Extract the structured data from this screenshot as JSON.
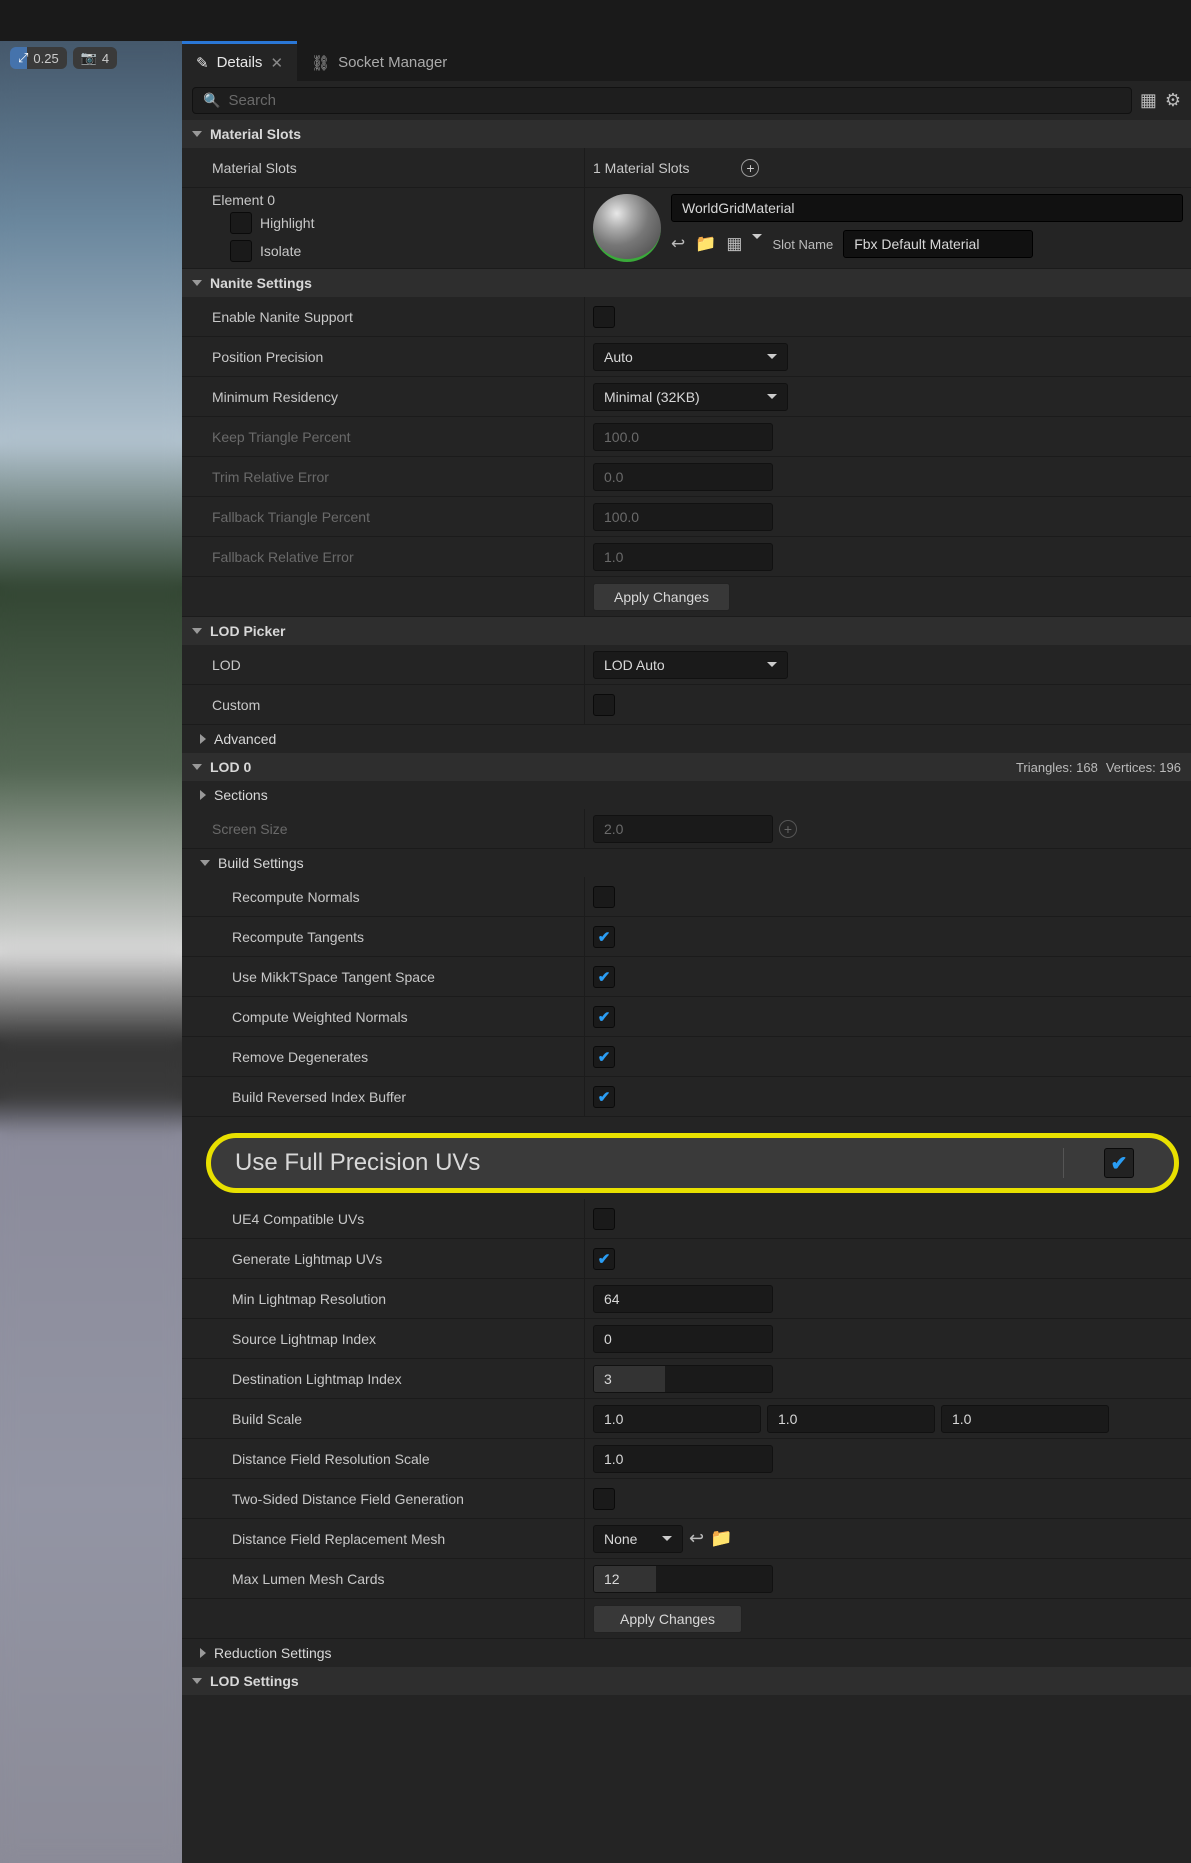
{
  "viewport": {
    "speed": "0.25",
    "cam": "4"
  },
  "tabs": {
    "details": "Details",
    "socket": "Socket Manager"
  },
  "search": {
    "placeholder": "Search"
  },
  "sections": {
    "materialSlots": {
      "header": "Material Slots",
      "label": "Material Slots",
      "count": "1 Material Slots",
      "element": "Element 0",
      "highlight": "Highlight",
      "isolate": "Isolate",
      "matName": "WorldGridMaterial",
      "slotNameLabel": "Slot Name",
      "slotName": "Fbx Default Material"
    },
    "nanite": {
      "header": "Nanite Settings",
      "enable": "Enable Nanite Support",
      "posPrec": "Position Precision",
      "posPrecVal": "Auto",
      "minRes": "Minimum Residency",
      "minResVal": "Minimal (32KB)",
      "keepTri": "Keep Triangle Percent",
      "keepTriVal": "100.0",
      "trimErr": "Trim Relative Error",
      "trimErrVal": "0.0",
      "fallTri": "Fallback Triangle Percent",
      "fallTriVal": "100.0",
      "fallErr": "Fallback Relative Error",
      "fallErrVal": "1.0",
      "apply": "Apply Changes"
    },
    "lodPicker": {
      "header": "LOD Picker",
      "lod": "LOD",
      "lodVal": "LOD Auto",
      "custom": "Custom",
      "advanced": "Advanced"
    },
    "lod0": {
      "header": "LOD 0",
      "tris": "Triangles: 168",
      "verts": "Vertices: 196",
      "sections": "Sections",
      "screenSize": "Screen Size",
      "screenSizeVal": "2.0",
      "build": "Build Settings",
      "recompNormals": "Recompute Normals",
      "recompTangents": "Recompute Tangents",
      "mikkt": "Use MikkTSpace Tangent Space",
      "weighted": "Compute Weighted Normals",
      "degen": "Remove Degenerates",
      "reversed": "Build Reversed Index Buffer",
      "fullPrec": "Use Full Precision UVs",
      "ue4uv": "UE4 Compatible UVs",
      "genLightmap": "Generate Lightmap UVs",
      "minLight": "Min Lightmap Resolution",
      "minLightVal": "64",
      "srcLight": "Source Lightmap Index",
      "srcLightVal": "0",
      "dstLight": "Destination Lightmap Index",
      "dstLightVal": "3",
      "buildScale": "Build Scale",
      "buildScaleX": "1.0",
      "buildScaleY": "1.0",
      "buildScaleZ": "1.0",
      "dfRes": "Distance Field Resolution Scale",
      "dfResVal": "1.0",
      "twoSided": "Two-Sided Distance Field Generation",
      "dfRepl": "Distance Field Replacement Mesh",
      "dfReplVal": "None",
      "lumen": "Max Lumen Mesh Cards",
      "lumenVal": "12",
      "apply": "Apply Changes",
      "reduction": "Reduction Settings"
    },
    "lodSettings": {
      "header": "LOD Settings"
    }
  }
}
